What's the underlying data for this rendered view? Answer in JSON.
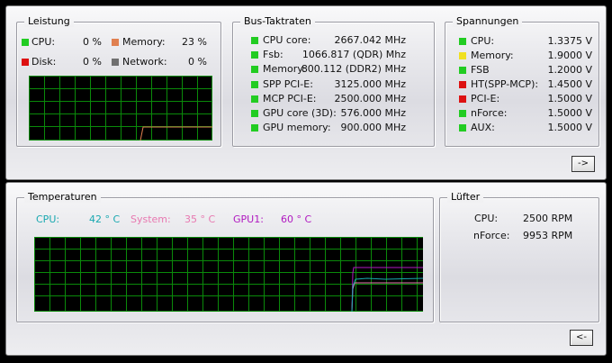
{
  "colors": {
    "green": "#22cc22",
    "red": "#dd1111",
    "orange": "#e08050",
    "gray": "#707070",
    "yellow": "#f0e020",
    "cyan": "#18a8b0",
    "pink": "#e878b0",
    "purple": "#b018c0"
  },
  "leistung": {
    "title": "Leistung",
    "items": [
      {
        "label": "CPU:",
        "value": "0 %",
        "color": "green"
      },
      {
        "label": "Memory:",
        "value": "23 %",
        "color": "orange"
      },
      {
        "label": "Disk:",
        "value": "0 %",
        "color": "red"
      },
      {
        "label": "Network:",
        "value": "0 %",
        "color": "gray"
      }
    ]
  },
  "bus": {
    "title": "Bus-Taktraten",
    "items": [
      {
        "label": "CPU core:",
        "value": "2667.042 MHz",
        "color": "green"
      },
      {
        "label": "Fsb:",
        "value": "1066.817 (QDR) Mhz",
        "color": "green"
      },
      {
        "label": "Memory:",
        "value": "800.112  (DDR2) MHz",
        "color": "green"
      },
      {
        "label": "SPP PCI-E:",
        "value": "3125.000 MHz",
        "color": "green"
      },
      {
        "label": "MCP PCI-E:",
        "value": "2500.000 MHz",
        "color": "green"
      },
      {
        "label": "GPU core (3D):",
        "value": "576.000 MHz",
        "color": "green"
      },
      {
        "label": "GPU memory:",
        "value": "900.000 MHz",
        "color": "green"
      }
    ]
  },
  "spannungen": {
    "title": "Spannungen",
    "items": [
      {
        "label": "CPU:",
        "value": "1.3375 V",
        "color": "green"
      },
      {
        "label": "Memory:",
        "value": "1.9000 V",
        "color": "yellow"
      },
      {
        "label": "FSB",
        "value": "1.2000 V",
        "color": "green"
      },
      {
        "label": "HT(SPP-MCP):",
        "value": "1.4500 V",
        "color": "red"
      },
      {
        "label": "PCI-E:",
        "value": "1.5000 V",
        "color": "red"
      },
      {
        "label": "nForce:",
        "value": "1.5000 V",
        "color": "green"
      },
      {
        "label": "AUX:",
        "value": "1.5000 V",
        "color": "green"
      }
    ]
  },
  "expand_button": "->",
  "collapse_button": "<-",
  "temperaturen": {
    "title": "Temperaturen",
    "items": [
      {
        "label": "CPU:",
        "value": "42 ° C",
        "color": "cyan"
      },
      {
        "label": "System:",
        "value": "35 ° C",
        "color": "pink"
      },
      {
        "label": "GPU1:",
        "value": "60 ° C",
        "color": "purple"
      }
    ]
  },
  "luefter": {
    "title": "Lüfter",
    "items": [
      {
        "label": "CPU:",
        "value": "2500 RPM"
      },
      {
        "label": "nForce:",
        "value": "9953 RPM"
      }
    ]
  }
}
